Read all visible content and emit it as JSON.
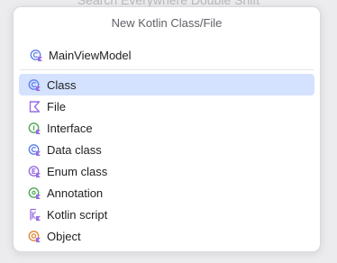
{
  "background_hint": "Search Everywhere Double Shift",
  "dialog": {
    "title": "New Kotlin Class/File",
    "input_value": "MainViewModel"
  },
  "items": [
    {
      "label": "Class",
      "icon": "kotlin-class-icon",
      "color": "#5e80f0",
      "selected": true
    },
    {
      "label": "File",
      "icon": "kotlin-file-icon",
      "color": "#9a6de4",
      "selected": false
    },
    {
      "label": "Interface",
      "icon": "kotlin-interface-icon",
      "color": "#4fa857",
      "selected": false
    },
    {
      "label": "Data class",
      "icon": "kotlin-data-class-icon",
      "color": "#5e80f0",
      "selected": false
    },
    {
      "label": "Enum class",
      "icon": "kotlin-enum-class-icon",
      "color": "#9a6de4",
      "selected": false
    },
    {
      "label": "Annotation",
      "icon": "kotlin-annotation-icon",
      "color": "#4fa857",
      "selected": false
    },
    {
      "label": "Kotlin script",
      "icon": "kotlin-script-icon",
      "color": "#9a6de4",
      "selected": false
    },
    {
      "label": "Object",
      "icon": "kotlin-object-icon",
      "color": "#e0883c",
      "selected": false
    }
  ],
  "colors": {
    "selection": "#d4e2ff",
    "kotlin_badge": "#9a6de4"
  }
}
